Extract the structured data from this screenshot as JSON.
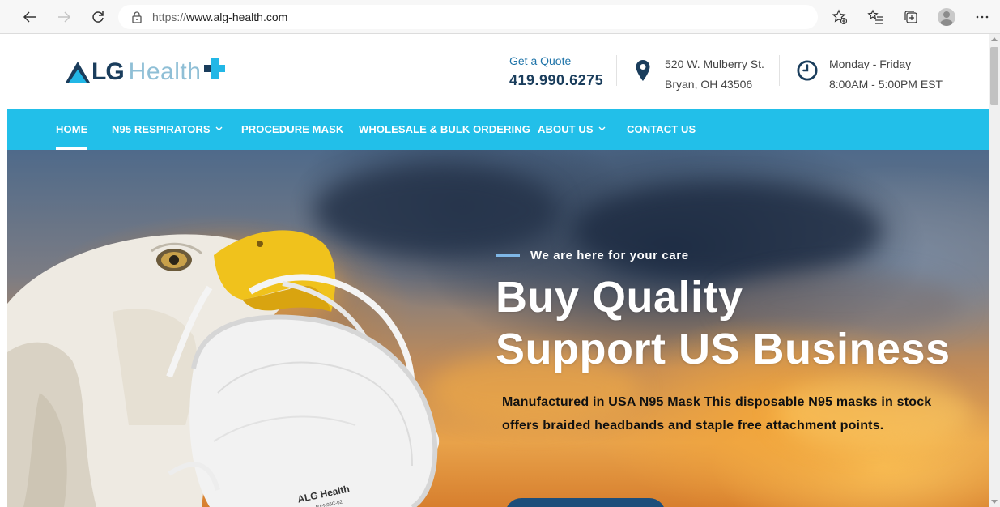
{
  "browser": {
    "url_protocol": "https://",
    "url_host": "www.alg-health.com"
  },
  "header": {
    "logo_lg": "LG",
    "logo_health": "Health",
    "quote_label": "Get a Quote",
    "phone": "419.990.6275",
    "address_line1": "520 W. Mulberry St.",
    "address_line2": "Bryan, OH 43506",
    "hours_line1": "Monday - Friday",
    "hours_line2": "8:00AM - 5:00PM EST"
  },
  "nav": {
    "items": [
      {
        "label": "HOME",
        "active": true
      },
      {
        "label": "N95 RESPIRATORS",
        "dropdown": true
      },
      {
        "label": "PROCEDURE MASK"
      },
      {
        "label": "WHOLESALE & BULK ORDERING"
      },
      {
        "label": "ABOUT US",
        "dropdown": true
      },
      {
        "label": "CONTACT US"
      }
    ]
  },
  "hero": {
    "tagline": "We are here for your care",
    "heading_line1": "Buy Quality",
    "heading_line2": "Support US Business",
    "description": "Manufactured in USA N95 Mask This disposable N95 masks in stock offers braided headbands and staple free attachment points.",
    "mask_brand": "ALG Health",
    "mask_model": "PT-N95C-02"
  },
  "colors": {
    "nav_bg": "#22bfe9",
    "brand_dark": "#1a3d5c",
    "brand_light": "#22b7e6",
    "cta_bg": "#1d4e7a"
  },
  "icons": {
    "back": "arrow-left-icon",
    "forward": "arrow-right-icon",
    "refresh": "refresh-icon",
    "lock": "lock-icon",
    "favorite_add": "star-plus-icon",
    "favorites": "favorites-list-icon",
    "collections": "collections-icon",
    "profile": "profile-avatar-icon",
    "more": "more-dots-icon",
    "map_pin": "map-pin-icon",
    "clock": "clock-icon"
  }
}
